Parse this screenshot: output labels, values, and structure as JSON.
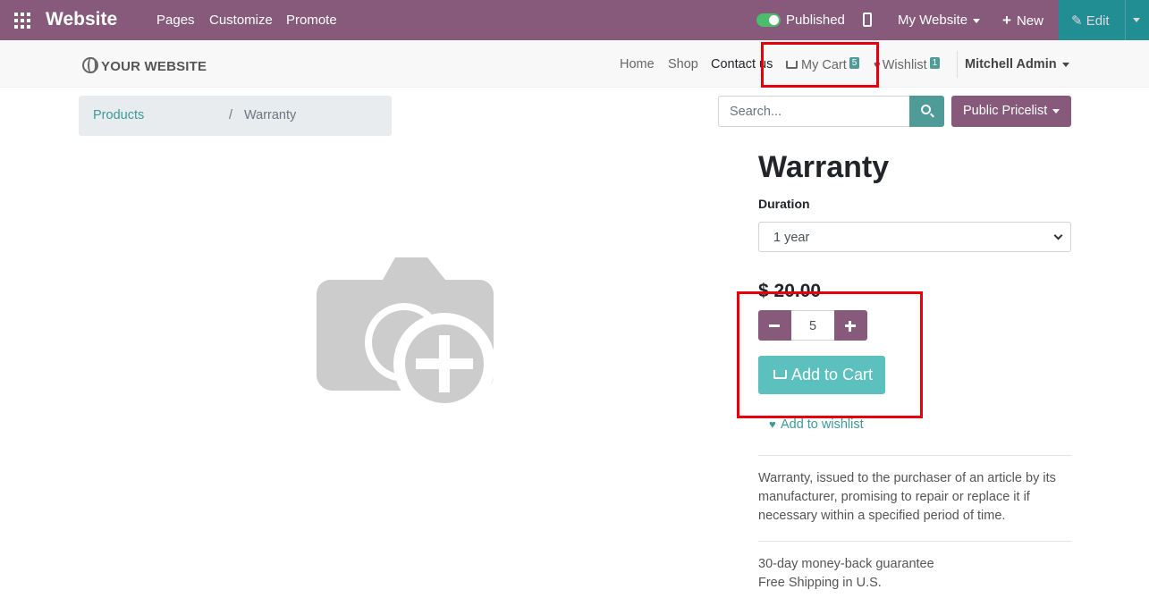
{
  "topbar": {
    "brand": "Website",
    "menu": [
      "Pages",
      "Customize",
      "Promote"
    ],
    "published_label": "Published",
    "site_selector": "My Website",
    "new_label": "New",
    "edit_label": "Edit",
    "bg_color": "#875a7b",
    "toggle_on": true
  },
  "header": {
    "logo_text": "YOUR WEBSITE",
    "nav": [
      "Home",
      "Shop",
      "Contact us"
    ],
    "cart_label": "My Cart",
    "cart_count": "5",
    "wishlist_label": "Wishlist",
    "wishlist_count": "1",
    "user_name": "Mitchell Admin"
  },
  "breadcrumb": {
    "parent": "Products",
    "separator": "/",
    "current": "Warranty"
  },
  "search": {
    "placeholder": "Search...",
    "pricelist_label": "Public Pricelist"
  },
  "product": {
    "name": "Warranty",
    "attribute_label": "Duration",
    "attribute_value": "1 year",
    "price": "$ 20.00",
    "quantity": "5",
    "add_to_cart_label": "Add to Cart",
    "wishlist_link": "Add to wishlist",
    "description": "Warranty, issued to the purchaser of an article by its manufacturer, promising to repair or replace it if necessary within a specified period of time.",
    "terms": [
      "30-day money-back guarantee",
      "Free Shipping in U.S."
    ]
  },
  "colors": {
    "accent_teal": "#4e9b98",
    "add_to_cart": "#5bc0be",
    "annotation_red": "#e8000b"
  }
}
